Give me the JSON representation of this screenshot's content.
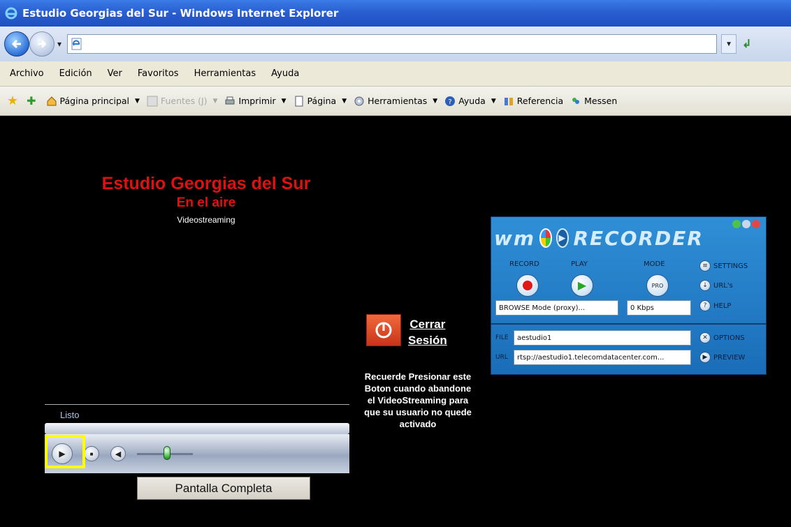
{
  "window": {
    "title": "Estudio Georgias del Sur - Windows Internet Explorer"
  },
  "address_bar": {
    "url": ""
  },
  "menu": [
    "Archivo",
    "Edición",
    "Ver",
    "Favoritos",
    "Herramientas",
    "Ayuda"
  ],
  "command_bar": {
    "home": "Página principal",
    "feeds": "Fuentes (J)",
    "print": "Imprimir",
    "page": "Página",
    "tools": "Herramientas",
    "help": "Ayuda",
    "research": "Referencia",
    "messenger": "Messen"
  },
  "page": {
    "title": "Estudio Georgias del Sur",
    "subtitle": "En el aire",
    "caption": "Videostreaming"
  },
  "player": {
    "status": "Listo",
    "fullscreen_label": "Pantalla Completa"
  },
  "logout": {
    "line1": "Cerrar",
    "line2": "Sesión",
    "reminder": "Recuerde Presionar este Boton cuando abandone el VideoStreaming para que su usuario no quede activado"
  },
  "recorder": {
    "logo": "wm",
    "name": "RECORDER",
    "record_label": "RECORD",
    "play_label": "PLAY",
    "mode_label": "MODE",
    "mode_button": "PRO",
    "settings_label": "SETTINGS",
    "urls_label": "URL's",
    "help_label": "HELP",
    "browse_mode": "BROWSE Mode (proxy)...",
    "speed": "0 Kbps",
    "file_label": "FILE",
    "file_value": "aestudio1",
    "url_label": "URL",
    "url_value": "rtsp://aestudio1.telecomdatacenter.com...",
    "options_label": "OPTIONS",
    "preview_label": "PREVIEW"
  },
  "colors": {
    "title_red": "#e01010",
    "highlight": "#ffff00",
    "recorder_blue": "#2f8fd6"
  }
}
